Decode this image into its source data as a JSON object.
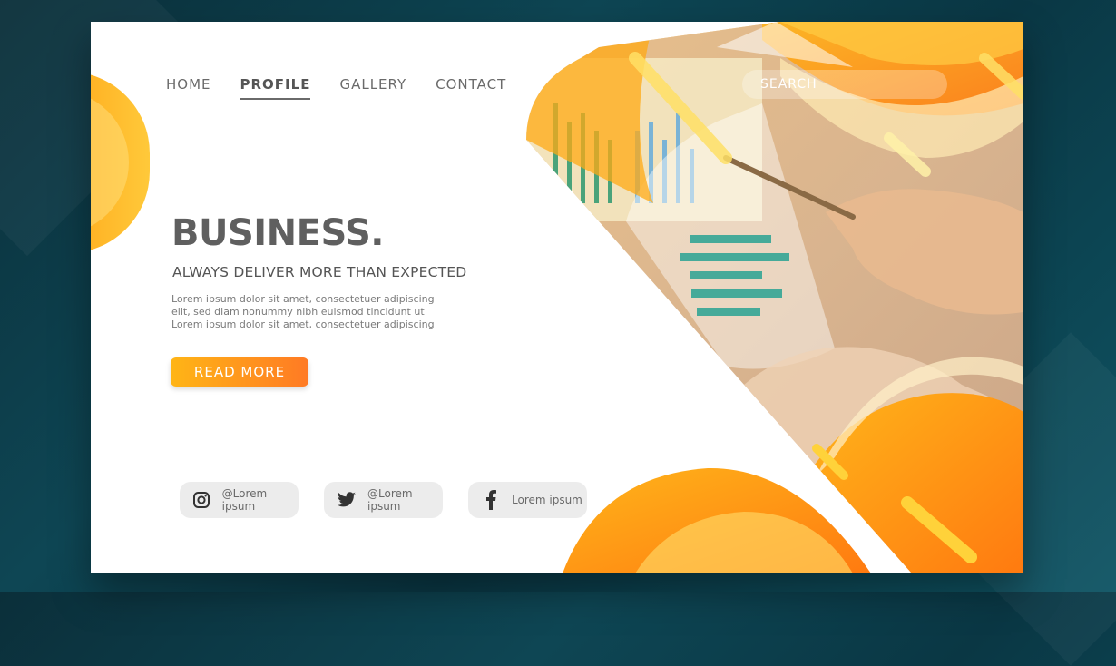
{
  "nav": {
    "items": [
      {
        "label": "HOME",
        "active": false
      },
      {
        "label": "PROFILE",
        "active": true
      },
      {
        "label": "GALLERY",
        "active": false
      },
      {
        "label": "CONTACT",
        "active": false
      }
    ]
  },
  "search": {
    "placeholder": "SEARCH"
  },
  "hero": {
    "title": "BUSINESS.",
    "subtitle": "ALWAYS DELIVER MORE THAN EXPECTED",
    "body_lines": [
      "Lorem ipsum dolor sit amet, consectetuer adipiscing",
      "elit, sed diam nonummy nibh euismod tincidunt ut",
      "Lorem ipsum dolor sit amet, consectetuer adipiscing"
    ],
    "cta_label": "READ MORE"
  },
  "socials": [
    {
      "icon": "instagram-icon",
      "handle": "@Lorem ipsum"
    },
    {
      "icon": "twitter-icon",
      "handle": "@Lorem ipsum"
    },
    {
      "icon": "facebook-icon",
      "handle": "Lorem ipsum"
    }
  ],
  "colors": {
    "accent_orange": "#ff8a1c",
    "accent_yellow": "#ffc233",
    "text_dark": "#5f5f5f",
    "page_bg": "#0e4654"
  }
}
